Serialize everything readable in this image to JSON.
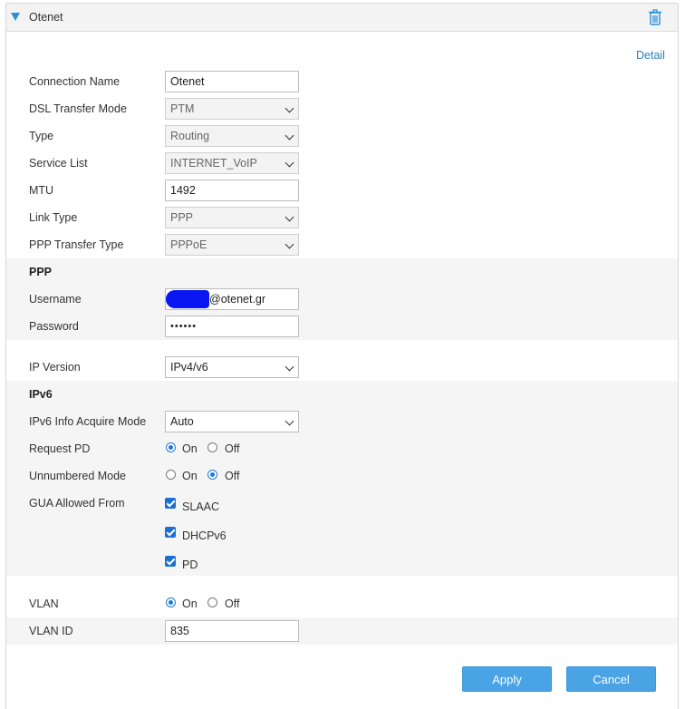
{
  "header": {
    "title": "Otenet",
    "expand_icon": "triangle-down-icon",
    "delete_icon": "trash-icon"
  },
  "detail_link": "Detail",
  "fields": {
    "connection_name": {
      "label": "Connection Name",
      "value": "Otenet"
    },
    "dsl_transfer_mode": {
      "label": "DSL Transfer Mode",
      "value": "PTM"
    },
    "type": {
      "label": "Type",
      "value": "Routing"
    },
    "service_list": {
      "label": "Service List",
      "value": "INTERNET_VoIP"
    },
    "mtu": {
      "label": "MTU",
      "value": "1492"
    },
    "link_type": {
      "label": "Link Type",
      "value": "PPP"
    },
    "ppp_transfer_type": {
      "label": "PPP Transfer Type",
      "value": "PPPoE"
    }
  },
  "ppp": {
    "section": "PPP",
    "username": {
      "label": "Username",
      "value": "@otenet.gr"
    },
    "password": {
      "label": "Password",
      "value": "••••••"
    }
  },
  "ip_version": {
    "label": "IP Version",
    "value": "IPv4/v6"
  },
  "ipv6": {
    "section": "IPv6",
    "acquire_mode": {
      "label": "IPv6 Info Acquire Mode",
      "value": "Auto"
    },
    "request_pd": {
      "label": "Request PD",
      "on": "On",
      "off": "Off",
      "selected": "On"
    },
    "unnumbered": {
      "label": "Unnumbered Mode",
      "on": "On",
      "off": "Off",
      "selected": "Off"
    },
    "gua": {
      "label": "GUA Allowed From",
      "options": [
        "SLAAC",
        "DHCPv6",
        "PD"
      ]
    }
  },
  "vlan": {
    "label": "VLAN",
    "on": "On",
    "off": "Off",
    "selected": "On",
    "id": {
      "label": "VLAN ID",
      "value": "835"
    }
  },
  "buttons": {
    "apply": "Apply",
    "cancel": "Cancel"
  },
  "colors": {
    "accent": "#2a8fd8",
    "link": "#2a7fc1",
    "button": "#4aa3e4",
    "redaction": "#0a16f2"
  }
}
